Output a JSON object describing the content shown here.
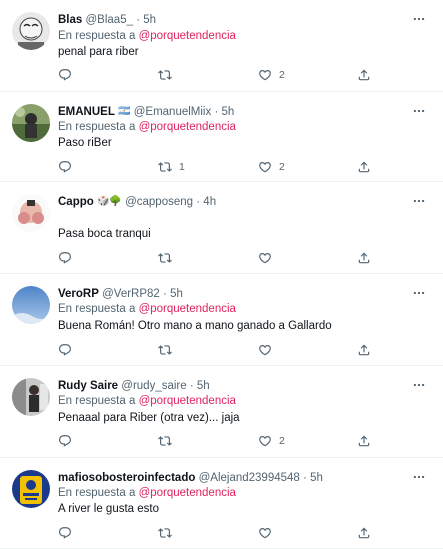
{
  "reply_prefix": "En respuesta a",
  "tweets": [
    {
      "name": "Blas",
      "emoji": "",
      "handle": "@Blaa5_",
      "dot": "·",
      "time": "5h",
      "mention": "@porquetendencia",
      "text": "penal para riber",
      "replies": "",
      "retweets": "",
      "likes": "2"
    },
    {
      "name": "EMANUEL",
      "emoji": "🇦🇷",
      "handle": "@EmanuelMiix",
      "dot": "·",
      "time": "5h",
      "mention": "@porquetendencia",
      "text": "Paso riBer",
      "replies": "",
      "retweets": "1",
      "likes": "2"
    },
    {
      "name": "Cappo",
      "emoji": "🎲🌳",
      "handle": "@capposeng",
      "dot": "·",
      "time": "4h",
      "mention": "",
      "text": "Pasa boca tranqui",
      "replies": "",
      "retweets": "",
      "likes": ""
    },
    {
      "name": "VeroRP",
      "emoji": "",
      "handle": "@VerRP82",
      "dot": "·",
      "time": "5h",
      "mention": "@porquetendencia",
      "text": "Buena Román! Otro mano a mano ganado a Gallardo",
      "replies": "",
      "retweets": "",
      "likes": ""
    },
    {
      "name": "Rudy Saire",
      "emoji": "",
      "handle": "@rudy_saire",
      "dot": "·",
      "time": "5h",
      "mention": "@porquetendencia",
      "text": "Penaaal para Riber (otra vez)... jaja",
      "replies": "",
      "retweets": "",
      "likes": "2"
    },
    {
      "name": "mafiosobosteroinfectado",
      "emoji": "",
      "handle": "@Alejand23994548",
      "dot": "·",
      "time": "5h",
      "mention": "@porquetendencia",
      "text": "A river le gusta esto",
      "replies": "",
      "retweets": "",
      "likes": ""
    }
  ],
  "icons": {
    "reply": "reply-icon",
    "retweet": "retweet-icon",
    "like": "like-icon",
    "share": "share-icon",
    "more": "more-icon"
  },
  "colors": {
    "mention": "#e0245e",
    "secondary": "#536471",
    "text": "#0f1419",
    "divider": "#eff3f4"
  }
}
